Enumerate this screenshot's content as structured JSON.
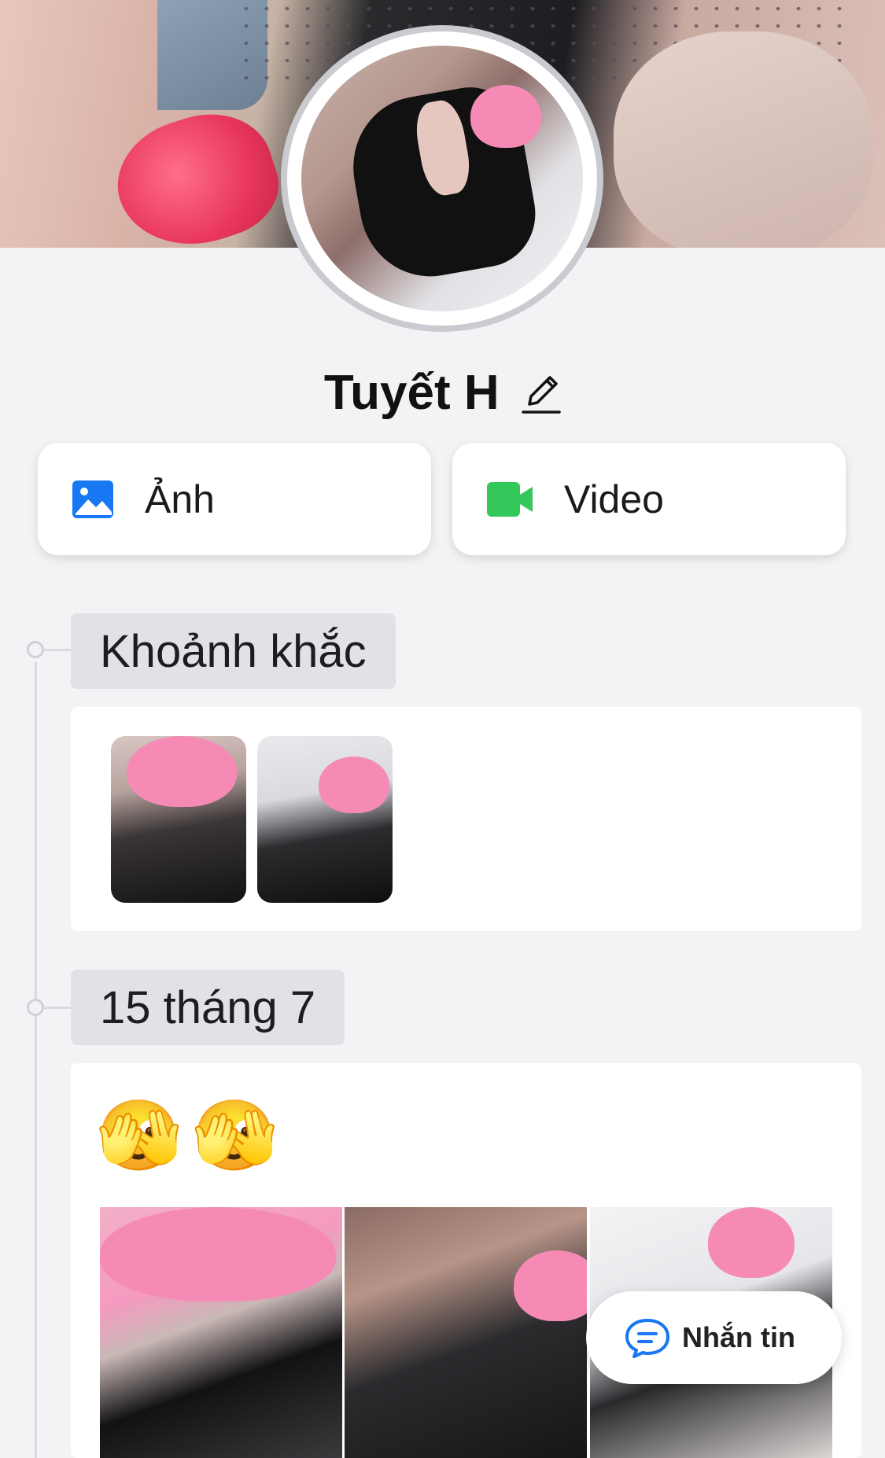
{
  "profile": {
    "name": "Tuyết H",
    "edit_icon": "pencil-icon",
    "cover_image": "cover-photo",
    "avatar_image": "avatar-photo"
  },
  "actions": {
    "photo_label": "Ảnh",
    "photo_icon": "image-icon",
    "photo_icon_color": "#1877f2",
    "video_label": "Video",
    "video_icon": "video-camera-icon",
    "video_icon_color": "#34c759"
  },
  "timeline": {
    "moments_label": "Khoảnh khắc",
    "post_date": "15 tháng 7",
    "post_text": "🫣🫣"
  },
  "message_button": {
    "label": "Nhắn tin",
    "icon": "chat-bubble-icon",
    "icon_color": "#1877f2"
  }
}
